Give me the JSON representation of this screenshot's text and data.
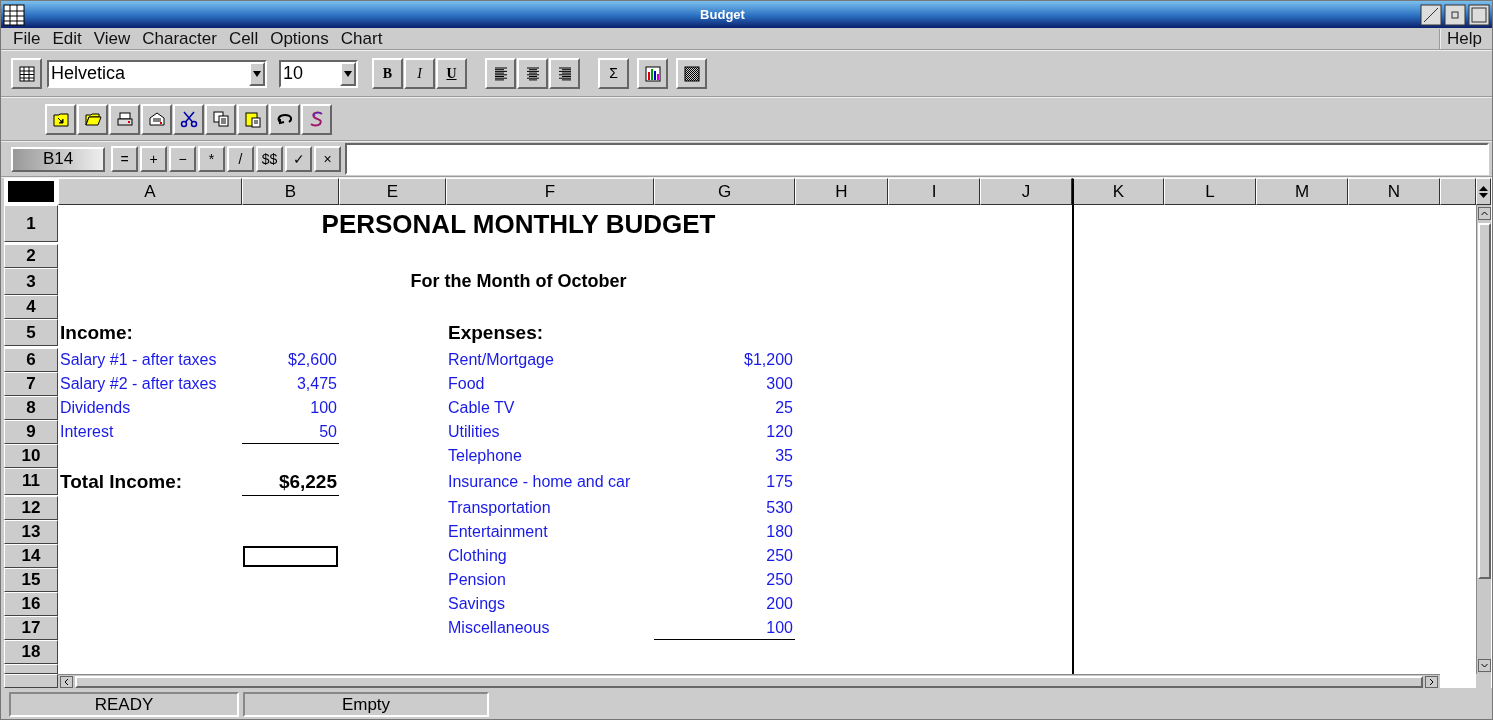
{
  "window": {
    "title": "Budget"
  },
  "menu": [
    "File",
    "Edit",
    "View",
    "Character",
    "Cell",
    "Options",
    "Chart"
  ],
  "help_menu": "Help",
  "format_toolbar": {
    "font": "Helvetica",
    "size": "10",
    "style_buttons": [
      "B",
      "I",
      "U"
    ],
    "sum_button": "Σ"
  },
  "formula_bar": {
    "cell_ref": "B14",
    "operators": [
      "=",
      "+",
      "−",
      "*",
      "/",
      "$$",
      "✓",
      "×"
    ]
  },
  "sheet": {
    "columns": [
      "A",
      "B",
      "E",
      "F",
      "G",
      "H",
      "I",
      "J",
      "K",
      "L",
      "M",
      "N"
    ],
    "rows": [
      {
        "row": "1",
        "cells": [
          "",
          {
            "kind": "title",
            "text": "PERSONAL MONTHLY BUDGET",
            "underlined": false,
            "selected": false
          }
        ]
      },
      {
        "row": "2",
        "cells": []
      },
      {
        "row": "3",
        "cells": [
          "",
          {
            "kind": "subtitle",
            "text": "For the Month of October",
            "underlined": false,
            "selected": false
          }
        ]
      },
      {
        "row": "4",
        "cells": []
      },
      {
        "row": "5",
        "cells": [
          {
            "kind": "heading",
            "text": "Income:",
            "underlined": false,
            "selected": false
          },
          "",
          "",
          {
            "kind": "heading",
            "text": "Expenses:",
            "underlined": false,
            "selected": false
          }
        ]
      },
      {
        "row": "6",
        "cells": [
          {
            "kind": "label",
            "text": "Salary #1 - after taxes",
            "underlined": false,
            "selected": false
          },
          {
            "kind": "number",
            "text": "$2,600",
            "underlined": false,
            "selected": false
          },
          "",
          {
            "kind": "label",
            "text": "Rent/Mortgage",
            "underlined": false,
            "selected": false
          },
          {
            "kind": "number",
            "text": "$1,200",
            "underlined": false,
            "selected": false
          }
        ]
      },
      {
        "row": "7",
        "cells": [
          {
            "kind": "label",
            "text": "Salary #2 - after taxes",
            "underlined": false,
            "selected": false
          },
          {
            "kind": "number",
            "text": "3,475",
            "underlined": false,
            "selected": false
          },
          "",
          {
            "kind": "label",
            "text": "Food",
            "underlined": false,
            "selected": false
          },
          {
            "kind": "number",
            "text": "300",
            "underlined": false,
            "selected": false
          }
        ]
      },
      {
        "row": "8",
        "cells": [
          {
            "kind": "label",
            "text": "Dividends",
            "underlined": false,
            "selected": false
          },
          {
            "kind": "number",
            "text": "100",
            "underlined": false,
            "selected": false
          },
          "",
          {
            "kind": "label",
            "text": "Cable TV",
            "underlined": false,
            "selected": false
          },
          {
            "kind": "number",
            "text": "25",
            "underlined": false,
            "selected": false
          }
        ]
      },
      {
        "row": "9",
        "cells": [
          {
            "kind": "label",
            "text": "Interest",
            "underlined": false,
            "selected": false
          },
          {
            "kind": "number",
            "text": "50",
            "underlined": true,
            "selected": false
          },
          "",
          {
            "kind": "label",
            "text": "Utilities",
            "underlined": false,
            "selected": false
          },
          {
            "kind": "number",
            "text": "120",
            "underlined": false,
            "selected": false
          }
        ]
      },
      {
        "row": "10",
        "cells": [
          "",
          "",
          "",
          {
            "kind": "label",
            "text": "Telephone",
            "underlined": false,
            "selected": false
          },
          {
            "kind": "number",
            "text": "35",
            "underlined": false,
            "selected": false
          }
        ]
      },
      {
        "row": "11",
        "cells": [
          {
            "kind": "total_label",
            "text": "Total Income:",
            "underlined": false,
            "selected": false
          },
          {
            "kind": "total",
            "text": "$6,225",
            "underlined": true,
            "selected": false
          },
          "",
          {
            "kind": "label",
            "text": "Insurance - home and car",
            "underlined": false,
            "selected": false
          },
          {
            "kind": "number",
            "text": "175",
            "underlined": false,
            "selected": false
          }
        ]
      },
      {
        "row": "12",
        "cells": [
          "",
          "",
          "",
          {
            "kind": "label",
            "text": "Transportation",
            "underlined": false,
            "selected": false
          },
          {
            "kind": "number",
            "text": "530",
            "underlined": false,
            "selected": false
          }
        ]
      },
      {
        "row": "13",
        "cells": [
          "",
          "",
          "",
          {
            "kind": "label",
            "text": "Entertainment",
            "underlined": false,
            "selected": false
          },
          {
            "kind": "number",
            "text": "180",
            "underlined": false,
            "selected": false
          }
        ]
      },
      {
        "row": "14",
        "cells": [
          "",
          {
            "kind": "empty",
            "underlined": false,
            "selected": true
          },
          "",
          {
            "kind": "label",
            "text": "Clothing",
            "underlined": false,
            "selected": false
          },
          {
            "kind": "number",
            "text": "250",
            "underlined": false,
            "selected": false
          }
        ]
      },
      {
        "row": "15",
        "cells": [
          "",
          "",
          "",
          {
            "kind": "label",
            "text": "Pension",
            "underlined": false,
            "selected": false
          },
          {
            "kind": "number",
            "text": "250",
            "underlined": false,
            "selected": false
          }
        ]
      },
      {
        "row": "16",
        "cells": [
          "",
          "",
          "",
          {
            "kind": "label",
            "text": "Savings",
            "underlined": false,
            "selected": false
          },
          {
            "kind": "number",
            "text": "200",
            "underlined": false,
            "selected": false
          }
        ]
      },
      {
        "row": "17",
        "cells": [
          "",
          "",
          "",
          {
            "kind": "label",
            "text": "Miscellaneous",
            "underlined": false,
            "selected": false
          },
          {
            "kind": "number",
            "text": "100",
            "underlined": true,
            "selected": false
          }
        ]
      },
      {
        "row": "18",
        "cells": []
      }
    ]
  },
  "status_bar": [
    "READY",
    "Empty"
  ]
}
